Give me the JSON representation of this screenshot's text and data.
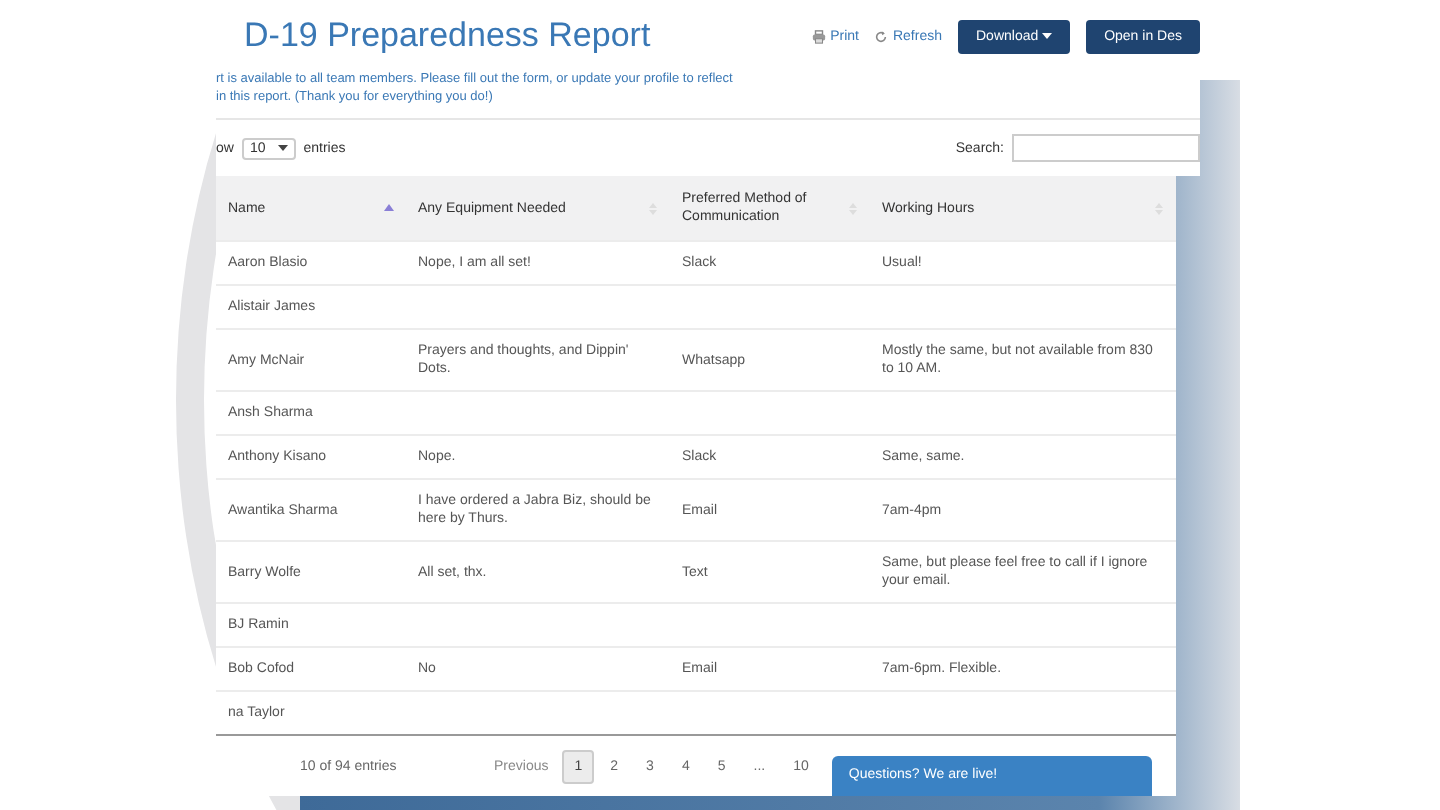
{
  "header": {
    "title": "D-19 Preparedness Report",
    "links": [
      {
        "kind": "print",
        "label": "Print"
      },
      {
        "kind": "refresh",
        "label": "Refresh"
      }
    ],
    "buttons": [
      {
        "kind": "dropdown",
        "label": "Download"
      },
      {
        "kind": "plain",
        "label": "Open in Des"
      }
    ],
    "description": [
      "rt is available to all team members. Please fill out the form, or update your profile to reflect",
      "in this report. (Thank you for everything you do!)"
    ]
  },
  "controls": {
    "show_prefix": "ow",
    "page_size": "10",
    "show_suffix": "entries",
    "search_label": "Search:"
  },
  "table": {
    "columns": [
      {
        "label": "Name",
        "sorted": true
      },
      {
        "label": "Any Equipment Needed",
        "sorted": false
      },
      {
        "label": "Preferred Method of Communication",
        "sorted": false
      },
      {
        "label": "Working Hours",
        "sorted": false
      }
    ],
    "rows": [
      [
        "Aaron Blasio",
        "Nope, I am all set!",
        "Slack",
        "Usual!"
      ],
      [
        "Alistair James",
        "",
        "",
        ""
      ],
      [
        "Amy McNair",
        "Prayers and thoughts, and Dippin' Dots.",
        "Whatsapp",
        "Mostly the same, but not available from 830 to 10 AM."
      ],
      [
        "Ansh Sharma",
        "",
        "",
        ""
      ],
      [
        "Anthony Kisano",
        "Nope.",
        "Slack",
        "Same, same."
      ],
      [
        "Awantika Sharma",
        "I have ordered a Jabra Biz, should be here by Thurs.",
        "Email",
        "7am-4pm"
      ],
      [
        "Barry Wolfe",
        "All set, thx.",
        "Text",
        "Same, but please feel free to call if I ignore your email."
      ],
      [
        "BJ Ramin",
        "",
        "",
        ""
      ],
      [
        "Bob Cofod",
        "No",
        "Email",
        "7am-6pm. Flexible."
      ],
      [
        "na Taylor",
        "",
        "",
        ""
      ]
    ]
  },
  "footer": {
    "info": "10 of 94 entries",
    "previous": "Previous",
    "pages": [
      {
        "label": "1",
        "selected": true
      },
      {
        "label": "2",
        "selected": false
      },
      {
        "label": "3",
        "selected": false
      },
      {
        "label": "4",
        "selected": false
      },
      {
        "label": "5",
        "selected": false
      },
      {
        "label": "...",
        "selected": false
      },
      {
        "label": "10",
        "selected": false
      }
    ],
    "chat": "Questions? We are live!"
  }
}
